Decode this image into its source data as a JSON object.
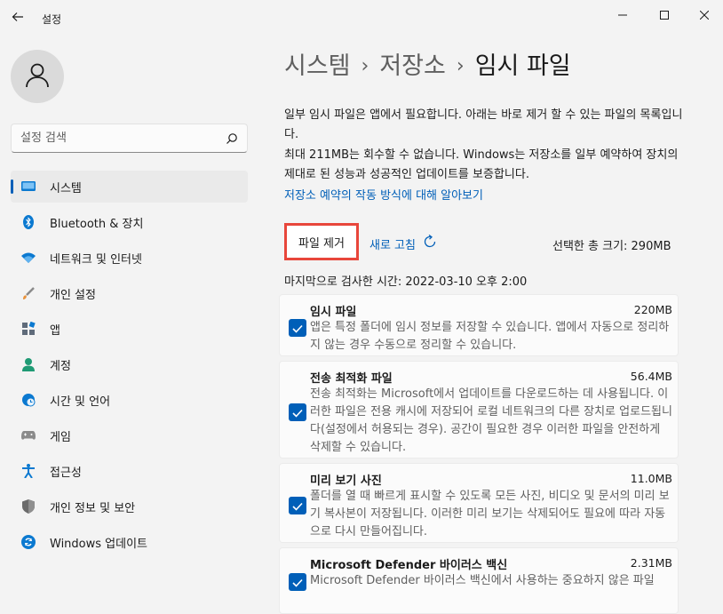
{
  "window": {
    "app_title": "설정",
    "icons": {
      "back": "back-arrow-icon",
      "minimize": "minimize-icon",
      "maximize": "maximize-icon",
      "close": "close-icon"
    }
  },
  "sidebar": {
    "search": {
      "placeholder": "설정 검색"
    },
    "items": [
      {
        "label": "시스템",
        "icon": "system-icon",
        "active": true
      },
      {
        "label": "Bluetooth & 장치",
        "icon": "bluetooth-icon"
      },
      {
        "label": "네트워크 및 인터넷",
        "icon": "wifi-icon"
      },
      {
        "label": "개인 설정",
        "icon": "brush-icon"
      },
      {
        "label": "앱",
        "icon": "apps-icon"
      },
      {
        "label": "계정",
        "icon": "account-icon"
      },
      {
        "label": "시간 및 언어",
        "icon": "clock-globe-icon"
      },
      {
        "label": "게임",
        "icon": "gamepad-icon"
      },
      {
        "label": "접근성",
        "icon": "accessibility-icon"
      },
      {
        "label": "개인 정보 및 보안",
        "icon": "shield-icon"
      },
      {
        "label": "Windows 업데이트",
        "icon": "update-icon"
      }
    ]
  },
  "main": {
    "breadcrumb": {
      "item1": "시스템",
      "sep": "›",
      "item2": "저장소",
      "current": "임시 파일"
    },
    "description1": "일부 임시 파일은 앱에서 필요합니다. 아래는 바로 제거 할 수 있는 파일의 목록입니다.",
    "description2": "최대 211MB는 회수할 수 없습니다. Windows는 저장소를 일부 예약하여 장치의 제대로 된 성능과 성공적인 업데이트를 보증합니다.",
    "learn_link": "저장소 예약의 작동 방식에 대해 알아보기",
    "remove_button": "파일 제거",
    "refresh_button": "새로 고침",
    "total_selected": "선택한 총 크기: 290MB",
    "last_scan": "마지막으로 검사한 시간: 2022-03-10 오후 2:00",
    "items": [
      {
        "title": "임시 파일",
        "size": "220MB",
        "checked": true,
        "detail": "앱은 특정 폴더에 임시 정보를 저장할 수 있습니다. 앱에서 자동으로 정리하지 않는 경우 수동으로 정리할 수 있습니다."
      },
      {
        "title": "전송 최적화 파일",
        "size": "56.4MB",
        "checked": true,
        "detail": "전송 최적화는 Microsoft에서 업데이트를 다운로드하는 데 사용됩니다. 이러한 파일은 전용 캐시에 저장되어 로컬 네트워크의 다른 장치로 업로드됩니다(설정에서 허용되는 경우). 공간이 필요한 경우 이러한 파일을 안전하게 삭제할 수 있습니다."
      },
      {
        "title": "미리 보기 사진",
        "size": "11.0MB",
        "checked": true,
        "detail": "폴더를 열 때 빠르게 표시할 수 있도록 모든 사진, 비디오 및 문서의 미리 보기 복사본이 저장됩니다. 이러한 미리 보기는 삭제되어도 필요에 따라 자동으로 다시 만들어집니다."
      },
      {
        "title": "Microsoft Defender 바이러스 백신",
        "size": "2.31MB",
        "checked": true,
        "detail": "Microsoft Defender 바이러스 백신에서 사용하는 중요하지 않은 파일"
      }
    ]
  },
  "colors": {
    "accent": "#005fb8",
    "highlight_border": "#e8463b",
    "background": "#f3f3f3"
  }
}
